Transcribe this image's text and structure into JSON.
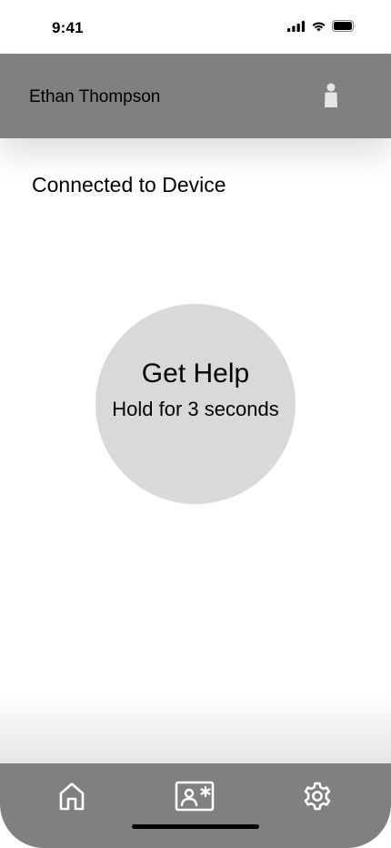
{
  "status_bar": {
    "time": "9:41",
    "icons": [
      "cellular-signal-icon",
      "wifi-icon",
      "battery-icon"
    ]
  },
  "header": {
    "user_name": "Ethan Thompson",
    "profile_icon": "person-icon"
  },
  "connection": {
    "status_text": "Connected to Device"
  },
  "help_button": {
    "title": "Get Help",
    "subtitle": "Hold for 3 seconds"
  },
  "tab_bar": {
    "tabs": [
      {
        "icon": "home-icon"
      },
      {
        "icon": "contact-card-icon"
      },
      {
        "icon": "gear-icon"
      }
    ]
  },
  "colors": {
    "header_background": "#808080",
    "tab_bar_background": "#808080",
    "help_button_background": "#d9d9d9",
    "icon_light": "#ffffff",
    "profile_icon": "#e6e6e6"
  }
}
